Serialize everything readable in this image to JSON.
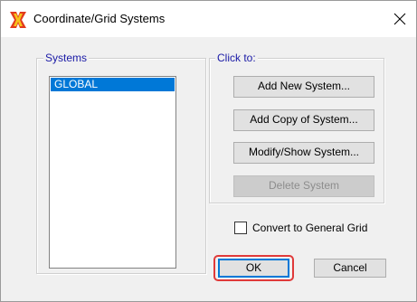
{
  "window": {
    "title": "Coordinate/Grid Systems",
    "app_icon": "sap-logo-icon",
    "close_icon": "close-icon"
  },
  "systems": {
    "group_label": "Systems",
    "items": [
      "GLOBAL"
    ],
    "selected_index": 0
  },
  "click_to": {
    "group_label": "Click to:",
    "buttons": {
      "add_new": "Add New System...",
      "add_copy": "Add Copy of System...",
      "modify_show": "Modify/Show System...",
      "delete": "Delete System"
    }
  },
  "convert": {
    "label": "Convert to General Grid",
    "checked": false
  },
  "footer": {
    "ok_label": "OK",
    "cancel_label": "Cancel"
  },
  "colors": {
    "selection": "#0078d7",
    "group_label": "#1a1aa6",
    "highlight": "#e03a3a"
  }
}
